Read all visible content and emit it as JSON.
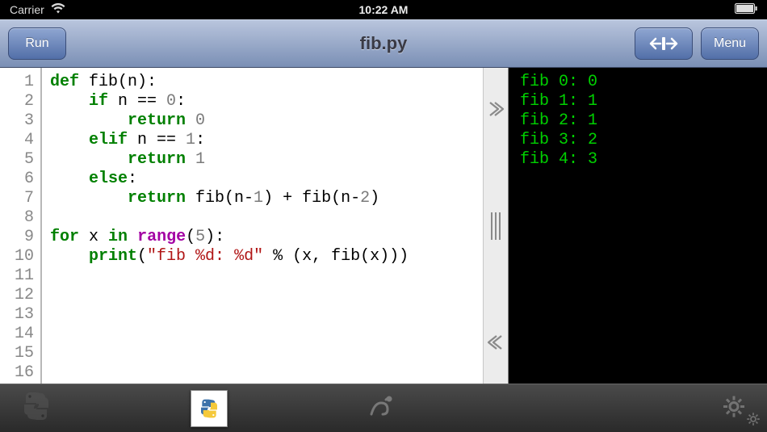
{
  "status": {
    "carrier": "Carrier",
    "time": "10:22 AM"
  },
  "toolbar": {
    "run_label": "Run",
    "title": "fib.py",
    "menu_label": "Menu"
  },
  "code": {
    "lines": [
      [
        [
          "kw",
          "def"
        ],
        [
          "",
          " fib(n):"
        ]
      ],
      [
        [
          "",
          "    "
        ],
        [
          "kw",
          "if"
        ],
        [
          "",
          " n == "
        ],
        [
          "num",
          "0"
        ],
        [
          "",
          ":"
        ]
      ],
      [
        [
          "",
          "        "
        ],
        [
          "kw",
          "return"
        ],
        [
          "",
          " "
        ],
        [
          "num",
          "0"
        ]
      ],
      [
        [
          "",
          "    "
        ],
        [
          "kw",
          "elif"
        ],
        [
          "",
          " n == "
        ],
        [
          "num",
          "1"
        ],
        [
          "",
          ":"
        ]
      ],
      [
        [
          "",
          "        "
        ],
        [
          "kw",
          "return"
        ],
        [
          "",
          " "
        ],
        [
          "num",
          "1"
        ]
      ],
      [
        [
          "",
          "    "
        ],
        [
          "kw",
          "else"
        ],
        [
          "",
          ":"
        ]
      ],
      [
        [
          "",
          "        "
        ],
        [
          "kw",
          "return"
        ],
        [
          "",
          " fib(n-"
        ],
        [
          "num",
          "1"
        ],
        [
          "",
          ") + fib(n-"
        ],
        [
          "num",
          "2"
        ],
        [
          "",
          ")"
        ]
      ],
      [],
      [
        [
          "kw",
          "for"
        ],
        [
          "",
          " x "
        ],
        [
          "kw",
          "in"
        ],
        [
          "",
          " "
        ],
        [
          "bn",
          "range"
        ],
        [
          "",
          "("
        ],
        [
          "num",
          "5"
        ],
        [
          "",
          "):"
        ]
      ],
      [
        [
          "",
          "    "
        ],
        [
          "kw",
          "print"
        ],
        [
          "",
          "("
        ],
        [
          "str",
          "\"fib %d: %d\""
        ],
        [
          "",
          " % (x, fib(x)))"
        ]
      ],
      [],
      [],
      [],
      [],
      [],
      []
    ]
  },
  "output_lines": [
    "fib 0: 0",
    "fib 1: 1",
    "fib 2: 1",
    "fib 3: 2",
    "fib 4: 3"
  ]
}
